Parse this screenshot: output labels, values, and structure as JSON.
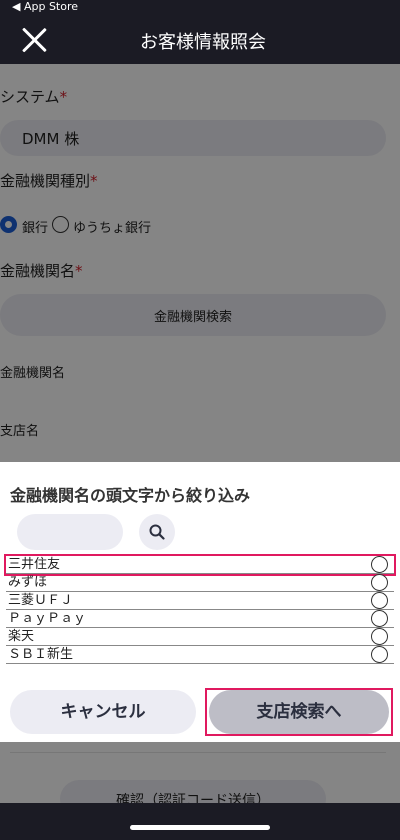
{
  "status_bar": {
    "back_app": "◀ App Store"
  },
  "nav": {
    "title": "お客様情報照会"
  },
  "form": {
    "system_label": "システム",
    "system_value": "DMM 株",
    "institution_type_label": "金融機関種別",
    "institution_types": [
      "銀行",
      "ゆうちょ銀行"
    ],
    "selected_type": "銀行",
    "institution_name_label": "金融機関名",
    "institution_search_button": "金融機関検索",
    "institution_name_field": "金融機関名",
    "branch_name_field": "支店名",
    "required_mark": "*",
    "confirm_button": "確認（認証コード送信）"
  },
  "sheet": {
    "title": "金融機関名の頭文字から絞り込み",
    "filter_placeholder": "",
    "banks": [
      {
        "name": "三井住友",
        "highlighted": true
      },
      {
        "name": "みずほ",
        "highlighted": false
      },
      {
        "name": "三菱ＵＦＪ",
        "highlighted": false
      },
      {
        "name": "ＰａｙＰａｙ",
        "highlighted": false
      },
      {
        "name": "楽天",
        "highlighted": false
      },
      {
        "name": "ＳＢＩ新生",
        "highlighted": false
      }
    ],
    "cancel_label": "キャンセル",
    "next_label": "支店検索へ"
  },
  "colors": {
    "nav_bg": "#1b1b24",
    "accent": "#1c5fd6",
    "required": "#d21f2b",
    "highlight_frame": "#e0195f",
    "pill_bg": "#ececf3"
  },
  "icons": [
    "close-icon",
    "search-icon",
    "radio-icon"
  ]
}
